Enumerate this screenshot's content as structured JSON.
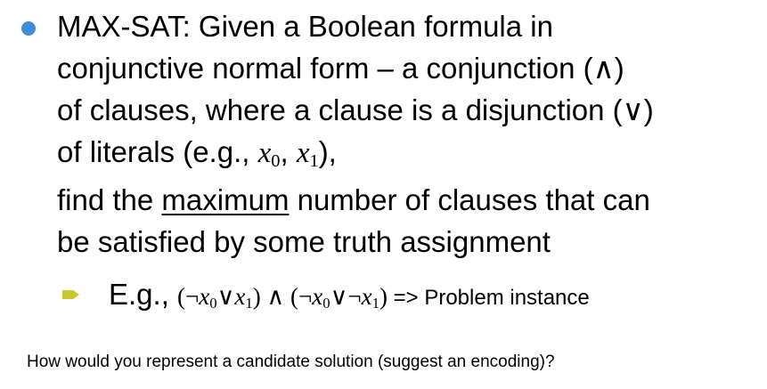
{
  "colors": {
    "bullet": "#3c8fd6",
    "arrow": "#c8c832"
  },
  "bullet": {
    "line1": "MAX-SAT: Given a Boolean formula in",
    "line2": "conjunctive normal form – a conjunction (∧)",
    "line3": "of clauses, where a clause is a disjunction (∨)",
    "line4_pre": "of literals (e.g., ",
    "x": "x",
    "sub0": "0",
    "sub1": "1",
    "comma": ", ",
    "line4_post": "),",
    "line5_pre": "find the ",
    "line5_ul": "maximum",
    "line5_post": " number of clauses that can",
    "line6": "be satisfied by some truth assignment"
  },
  "example": {
    "label": "E.g.,",
    "formula_a": "(¬",
    "or": "∨",
    "and": ") ∧ (¬",
    "not": "¬",
    "close": ")",
    "arrow_text": " => Problem instance"
  },
  "question": "How would you represent a candidate solution (suggest an encoding)?"
}
